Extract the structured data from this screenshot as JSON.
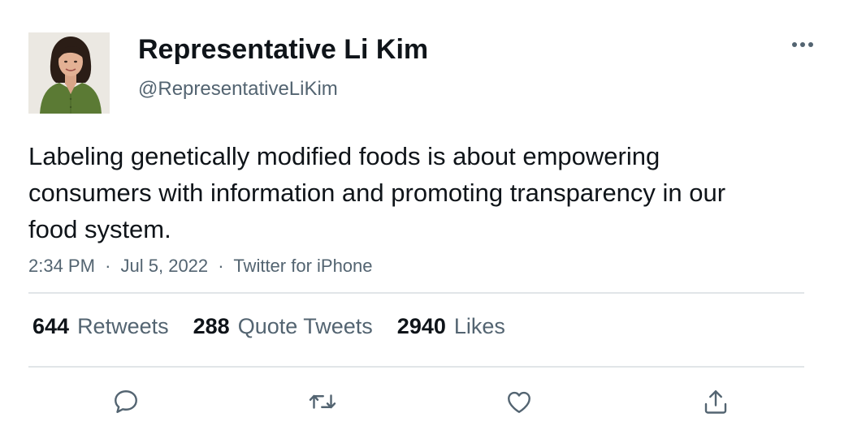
{
  "author": {
    "name": "Representative Li Kim",
    "handle": "@RepresentativeLiKim"
  },
  "tweet": {
    "text": "Labeling genetically modified foods is about empowering consumers with information and promoting transparency in our food system.",
    "time": "2:34 PM",
    "date": "Jul 5, 2022",
    "source": "Twitter for iPhone",
    "separator": "·"
  },
  "stats": {
    "retweets": {
      "count": "644",
      "label": "Retweets"
    },
    "quote_tweets": {
      "count": "288",
      "label": "Quote Tweets"
    },
    "likes": {
      "count": "2940",
      "label": "Likes"
    }
  },
  "actions": [
    "reply-icon",
    "retweet-icon",
    "like-icon",
    "share-icon"
  ],
  "colors": {
    "text": "#0f1419",
    "secondary": "#536471",
    "divider": "#e1e5e8",
    "avatar_shirt": "#5b7a34"
  }
}
